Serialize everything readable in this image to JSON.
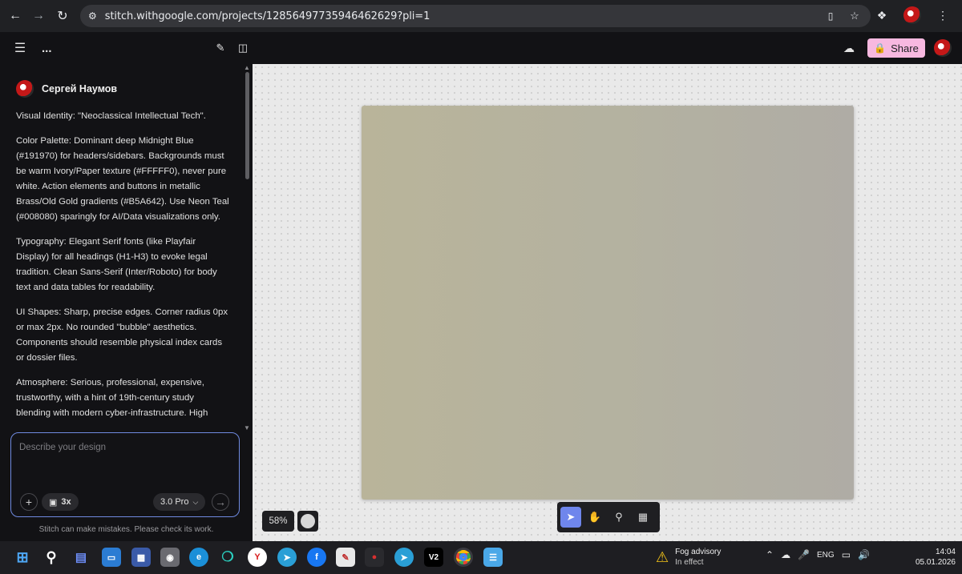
{
  "browser": {
    "url": "stitch.withgoogle.com/projects/12856497735946462629?pli=1"
  },
  "header": {
    "project_name": "...",
    "share_label": "Share"
  },
  "chat": {
    "author": "Сергей Наумов",
    "paragraphs": [
      "Visual Identity: \"Neoclassical Intellectual Tech\".",
      "Color Palette: Dominant deep Midnight Blue (#191970) for headers/sidebars. Backgrounds must be warm Ivory/Paper texture (#FFFFF0), never pure white. Action elements and buttons in metallic Brass/Old Gold gradients (#B5A642). Use Neon Teal (#008080) sparingly for AI/Data visualizations only.",
      "Typography: Elegant Serif fonts (like Playfair Display) for all headings (H1-H3) to evoke legal tradition. Clean Sans-Serif (Inter/Roboto) for body text and data tables for readability.",
      "UI Shapes: Sharp, precise edges. Corner radius 0px or max 2px. No rounded \"bubble\" aesthetics. Components should resemble physical index cards or dossier files.",
      "Atmosphere: Serious, professional, expensive, trustworthy, with a hint of 19th-century study blending with modern cyber-infrastructure. High"
    ]
  },
  "composer": {
    "placeholder": "Describe your design",
    "variants_label": "3x",
    "model_label": "3.0 Pro",
    "disclaimer": "Stitch can make mistakes. Please check its work."
  },
  "canvas": {
    "zoom": "58%"
  },
  "taskbar": {
    "weather_title": "Fog advisory",
    "weather_sub": "In effect",
    "language": "ENG",
    "time": "14:04",
    "date": "05.01.2026",
    "apps": [
      "V2"
    ]
  },
  "colors": {
    "accent_blue": "#6f86ec",
    "share_pink": "#f7b8e0",
    "artboard": "#b4b2a0"
  }
}
